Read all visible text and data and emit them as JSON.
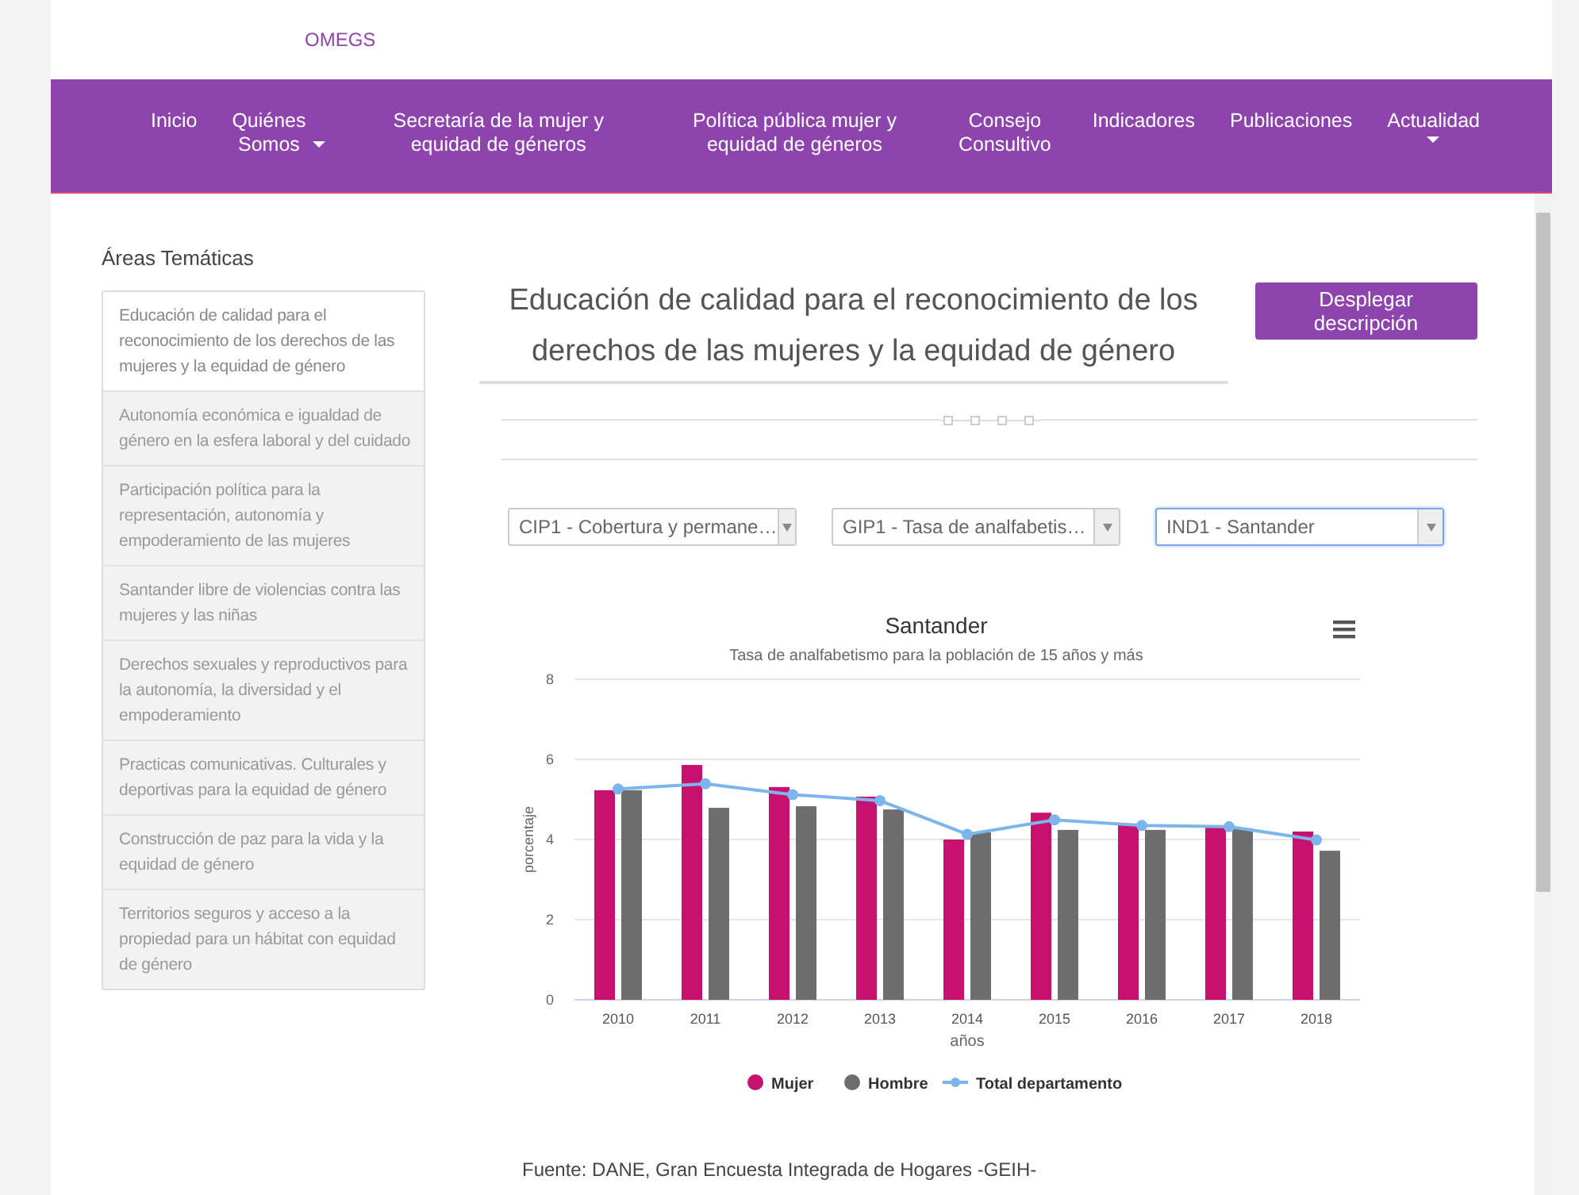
{
  "header": {
    "brand": "OMEGS"
  },
  "nav": [
    {
      "label": "Inicio"
    },
    {
      "label": "Quiénes\nSomos",
      "dropdown": true
    },
    {
      "label": "Secretaría de la mujer y\nequidad de géneros"
    },
    {
      "label": "Política pública mujer y\nequidad de géneros"
    },
    {
      "label": "Consejo\nConsultivo"
    },
    {
      "label": "Indicadores"
    },
    {
      "label": "Publicaciones"
    },
    {
      "label": "Actualidad",
      "dropdown": true
    }
  ],
  "sidebar": {
    "title": "Áreas Temáticas",
    "items": [
      {
        "label": "Educación de calidad para el reconocimiento de los derechos de las mujeres y la equidad de género",
        "selected": true
      },
      {
        "label": "Autonomía económica e igualdad de género en la esfera laboral y del cuidado",
        "selected": false
      },
      {
        "label": "Participación política para la representación, autonomía y empoderamiento de las mujeres",
        "selected": false
      },
      {
        "label": "Santander libre de violencias contra las mujeres y las niñas",
        "selected": false
      },
      {
        "label": "Derechos sexuales y reproductivos para la autonomía, la diversidad y el empoderamiento",
        "selected": false
      },
      {
        "label": "Practicas comunicativas. Culturales y deportivas para la equidad de género",
        "selected": false
      },
      {
        "label": "Construcción de paz para la vida y la equidad de género",
        "selected": false
      },
      {
        "label": "Territorios seguros y acceso a la propiedad para un hábitat con equidad de género",
        "selected": false
      }
    ]
  },
  "main": {
    "title": "Educación de calidad para el reconocimiento de los derechos de las mujeres y la equidad de género",
    "button": "Desplegar descripción",
    "selects": [
      {
        "value": "CIP1 - Cobertura y permane…",
        "focused": false
      },
      {
        "value": "GIP1 - Tasa de analfabetis…",
        "focused": false
      },
      {
        "value": "IND1 - Santander",
        "focused": true
      }
    ],
    "chart_data": {
      "type": "bar",
      "title": "Santander",
      "subtitle": "Tasa de analfabetismo para la población de 15 años y más",
      "xlabel": "años",
      "ylabel": "porcentaje",
      "categories": [
        "2010",
        "2011",
        "2012",
        "2013",
        "2014",
        "2015",
        "2016",
        "2017",
        "2018"
      ],
      "series": [
        {
          "name": "Mujer",
          "color": "#c8116e",
          "type": "bar",
          "values": [
            5.23,
            5.86,
            5.31,
            5.07,
            4.0,
            4.67,
            4.36,
            4.32,
            4.2
          ]
        },
        {
          "name": "Hombre",
          "color": "#6d6d6d",
          "type": "bar",
          "values": [
            5.23,
            4.79,
            4.83,
            4.75,
            4.18,
            4.24,
            4.24,
            4.28,
            3.72
          ]
        },
        {
          "name": "Total departamento",
          "color": "#7cb5ec",
          "type": "line",
          "marker": true,
          "values": [
            5.26,
            5.39,
            5.12,
            4.97,
            4.13,
            4.49,
            4.35,
            4.32,
            3.99
          ]
        }
      ],
      "ylim": [
        0,
        8
      ],
      "yticks": [
        0,
        2,
        4,
        6,
        8
      ],
      "grid": true,
      "legend": "bottom"
    },
    "source": "Fuente: DANE, Gran Encuesta Integrada de Hogares -GEIH-"
  }
}
